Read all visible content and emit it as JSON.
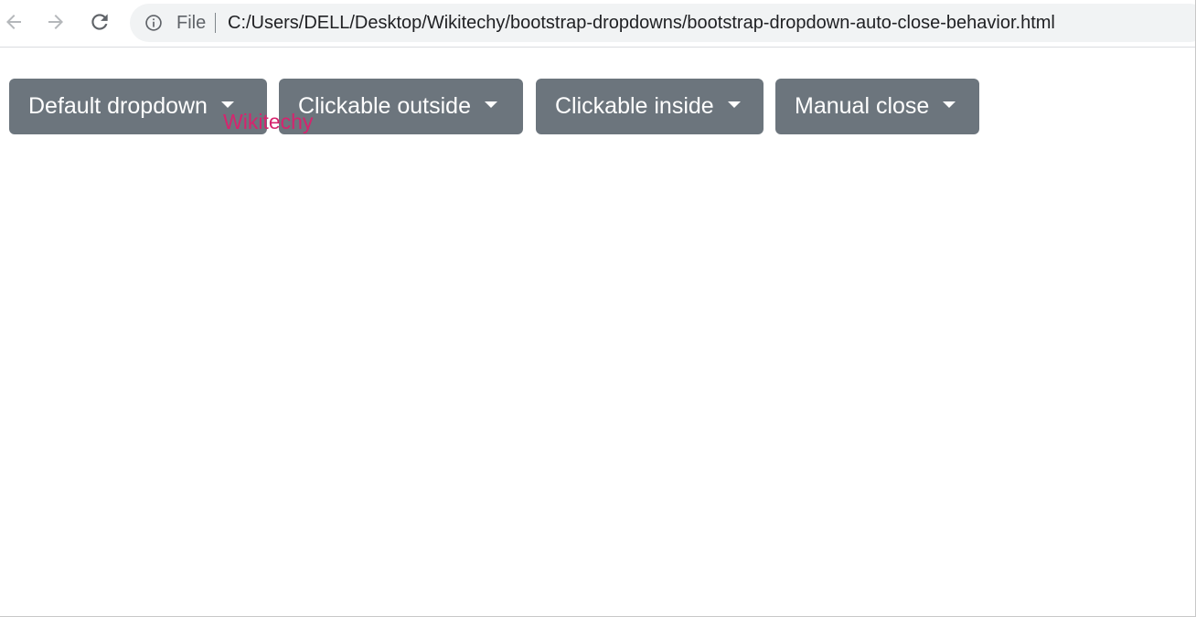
{
  "browser": {
    "scheme_label": "File",
    "url": "C:/Users/DELL/Desktop/Wikitechy/bootstrap-dropdowns/bootstrap-dropdown-auto-close-behavior.html",
    "icons": {
      "back": "arrow-left-icon",
      "forward": "arrow-right-icon",
      "reload": "reload-icon",
      "info": "info-icon"
    }
  },
  "page": {
    "buttons": [
      {
        "label": "Default dropdown"
      },
      {
        "label": "Clickable outside"
      },
      {
        "label": "Clickable inside"
      },
      {
        "label": "Manual close"
      }
    ],
    "watermark": "Wikitechy"
  },
  "colors": {
    "button_bg": "#6c757d",
    "button_text": "#ffffff",
    "watermark": "#d6246e"
  }
}
